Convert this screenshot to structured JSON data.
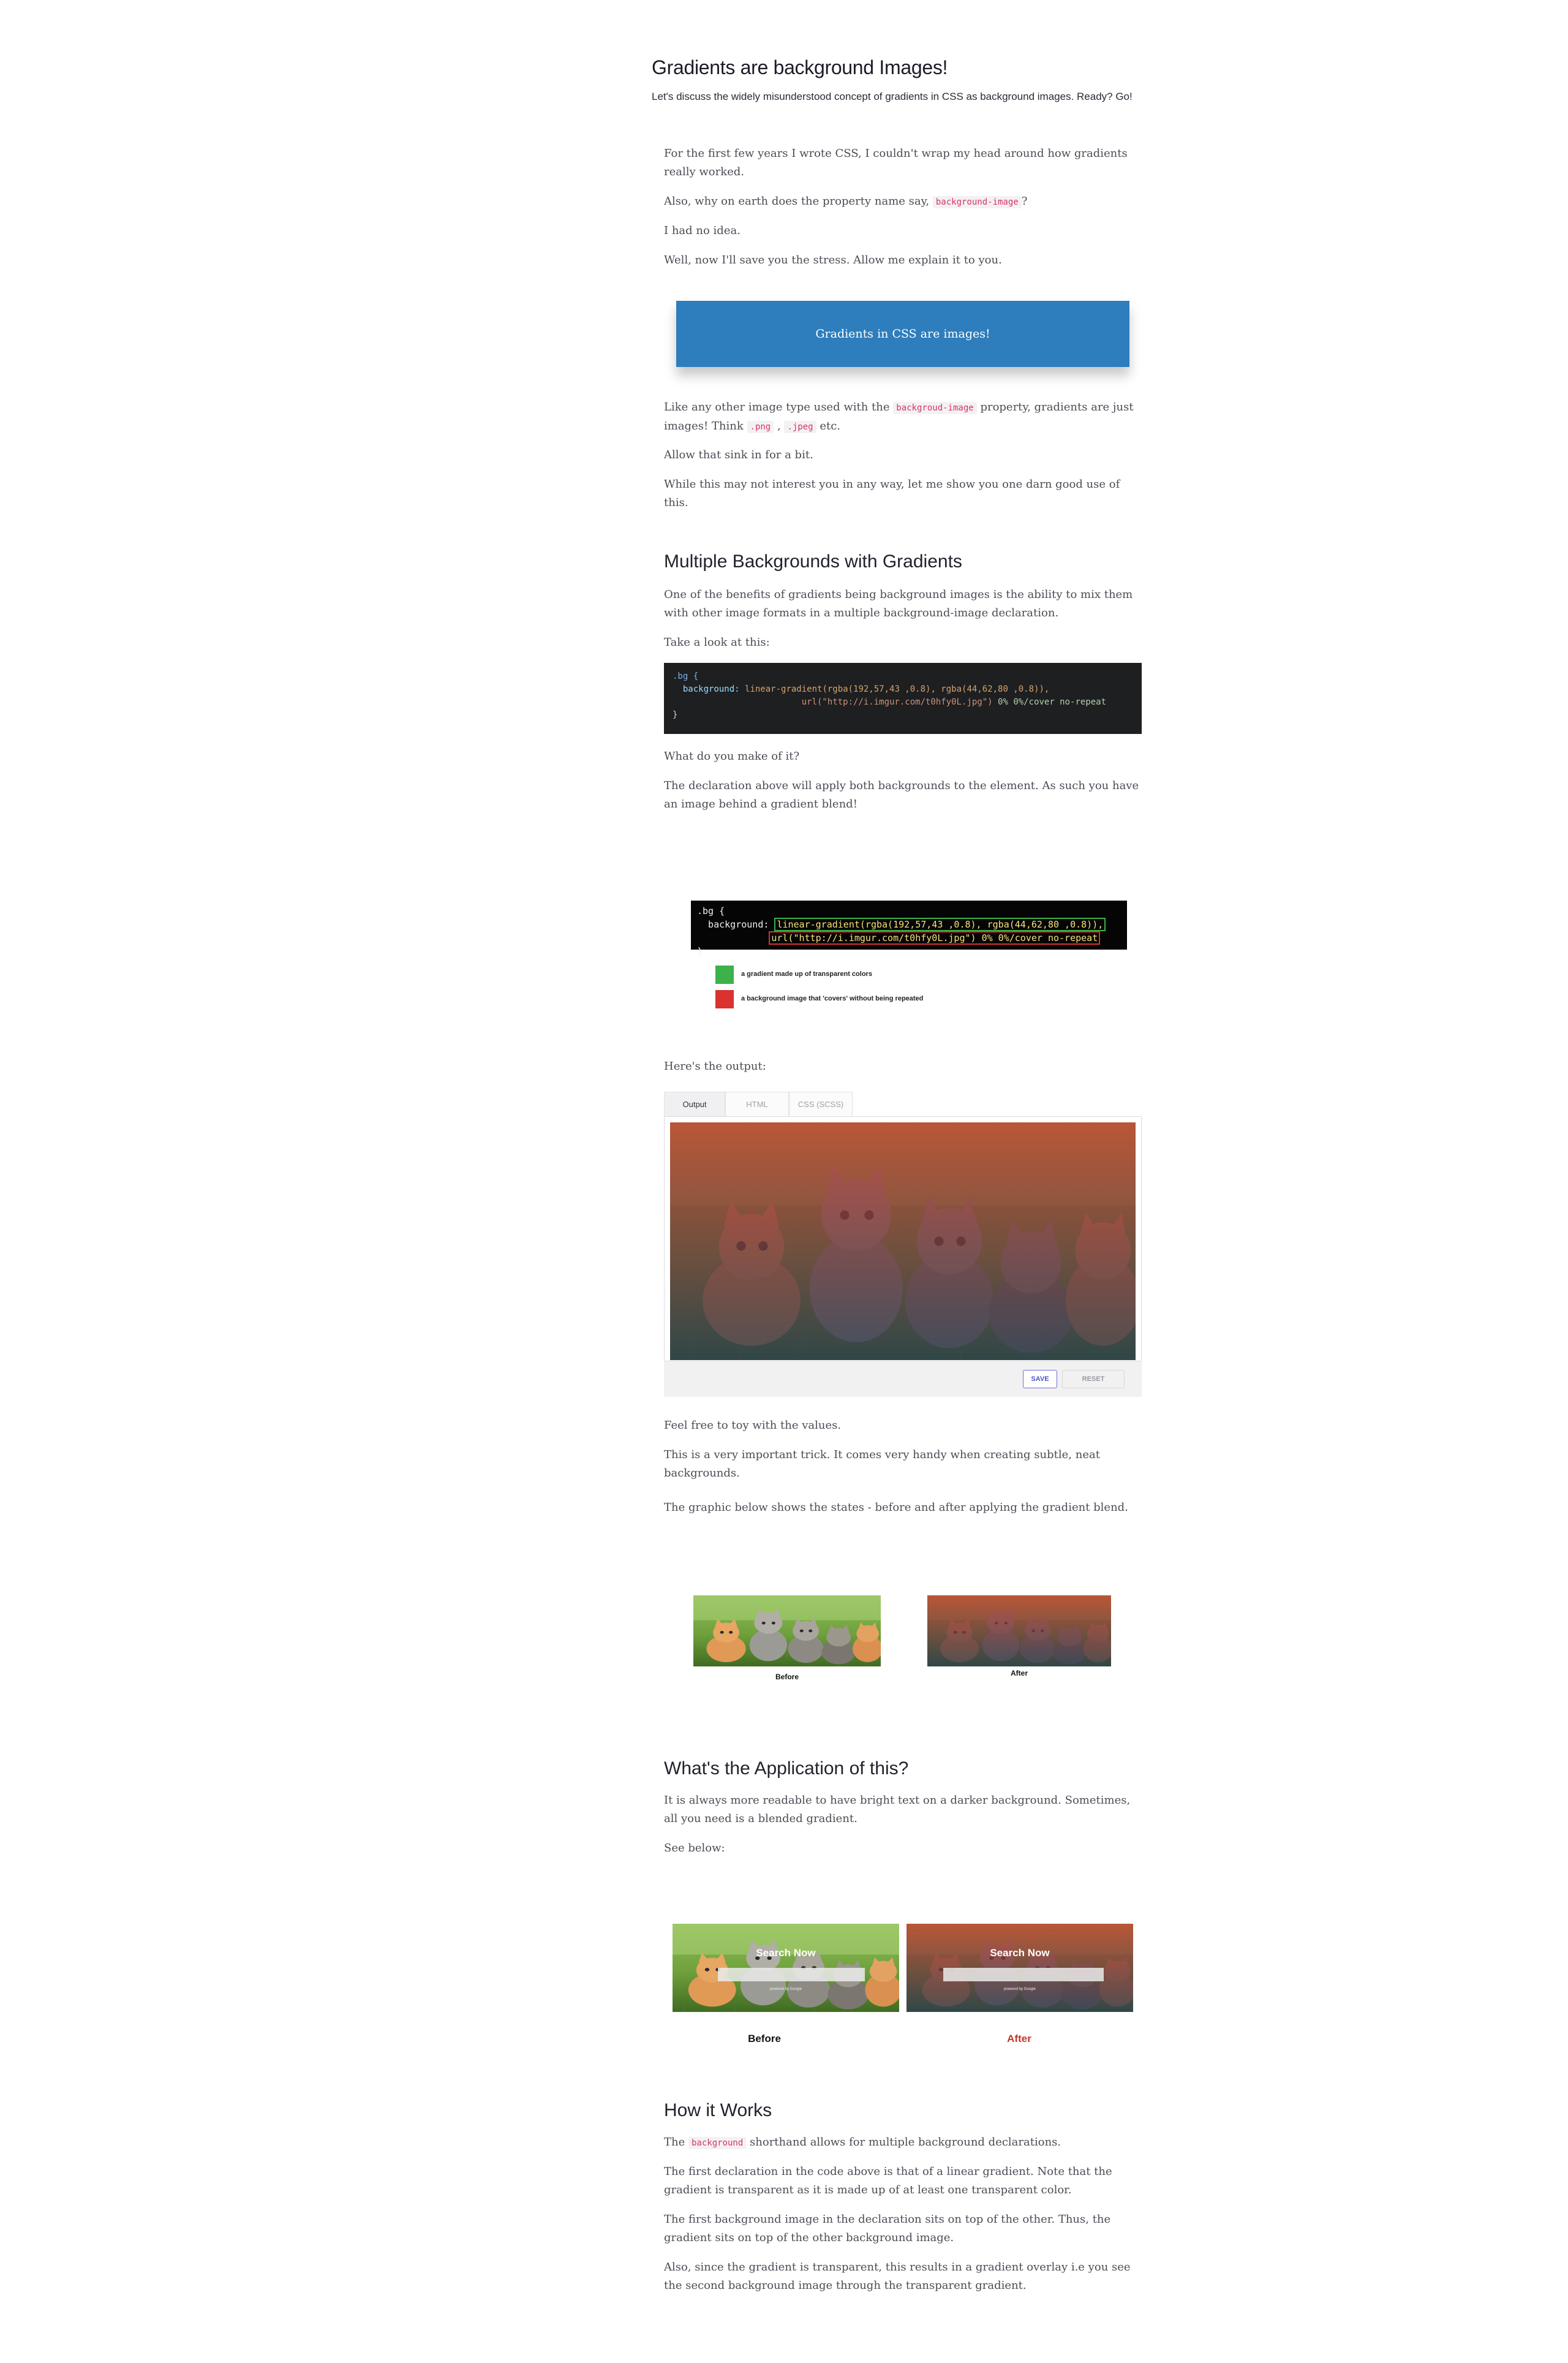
{
  "header": {
    "title": "Gradients are background Images!",
    "subtitle": "Let's discuss the widely misunderstood concept of gradients in CSS as background images. Ready? Go!"
  },
  "intro": {
    "p1": "For the first few years I wrote CSS, I couldn't wrap my head around how gradients really worked.",
    "p2_before": "Also, why on earth does the property name say,",
    "p2_code": "background-image",
    "p2_after": "?",
    "p3": "I had no idea.",
    "p4": "Well, now I'll save you the stress. Allow me explain it to you."
  },
  "callout": {
    "text": "Gradients in CSS are images!"
  },
  "images_section": {
    "p1_before": "Like any other image type used with the",
    "p1_code": "backgroud-image",
    "p1_mid": "property, gradients are just images! Think",
    "code_png": ".png",
    "comma": ",",
    "code_jpeg": ".jpeg",
    "p1_after": "etc.",
    "p2": "Allow that sink in for a bit.",
    "p3": "While this may not interest you in any way, let me show you one darn good use of this."
  },
  "multiple": {
    "heading": "Multiple Backgrounds with Gradients",
    "p1": "One of the benefits of gradients being background images is the ability to mix them with other image formats in a multiple background-image declaration.",
    "p2": "Take a look at this:",
    "code": {
      "l1_sel": ".bg {",
      "l2_prop": "background:",
      "l2_fn": "linear-gradient(rgba(192,57,43 ,0.8), rgba(44,62,80 ,0.8)),",
      "l3_url": "url(\"http://i.imgur.com/t0hfy0L.jpg\")",
      "l3_rest": "0% 0%/cover no-repeat",
      "l4": "}"
    },
    "p3": "What do you make of it?",
    "p4": "The declaration above will apply both backgrounds to the element. As such you have an image behind a gradient blend!"
  },
  "figure1": {
    "l1": ".bg {",
    "l2_prop": "  background: ",
    "l2_box": "linear-gradient(rgba(192,57,43 ,0.8), rgba(44,62,80 ,0.8)),",
    "l3_box": "url(\"http://i.imgur.com/t0hfy0L.jpg\") 0% 0%/cover no-repeat",
    "l4": "}",
    "legend_green": "a gradient made up of transparent colors",
    "legend_red": "a background image that 'covers' without being repeated",
    "green": "#3db14a",
    "red": "#d9322f"
  },
  "output": {
    "intro": "Here's the output:",
    "tabs": [
      "Output",
      "HTML",
      "CSS (SCSS)"
    ],
    "save": "SAVE",
    "reset": "RESET"
  },
  "after_output": {
    "p1": "Feel free to toy with the values.",
    "p2": "This is a very important trick. It comes very handy when creating subtle, neat backgrounds.",
    "p3": "The graphic below shows the states - before and after applying the gradient blend."
  },
  "before_after": {
    "before": "Before",
    "after": "After"
  },
  "application": {
    "heading": "What's the Application of this?",
    "p1": "It is always more readable to have bright text on a darker background. Sometimes, all you need is a blended gradient.",
    "p2": "See below:",
    "search_title": "Search Now",
    "powered": "powered by Google",
    "before": "Before",
    "after": "After",
    "after_color": "#c0392b"
  },
  "how": {
    "heading": "How it Works",
    "p1_before": "The",
    "p1_code": "background",
    "p1_after": "shorthand allows for multiple background declarations.",
    "p2": "The first declaration in the code above is that of a linear gradient. Note that the gradient is transparent as it is made up of at least one transparent color.",
    "p3": "The first background image in the declaration sits on top of the other. Thus, the gradient sits on top of the other background image.",
    "p4": "Also, since the gradient is transparent, this results in a gradient overlay i.e you see the second background image through the transparent gradient."
  }
}
